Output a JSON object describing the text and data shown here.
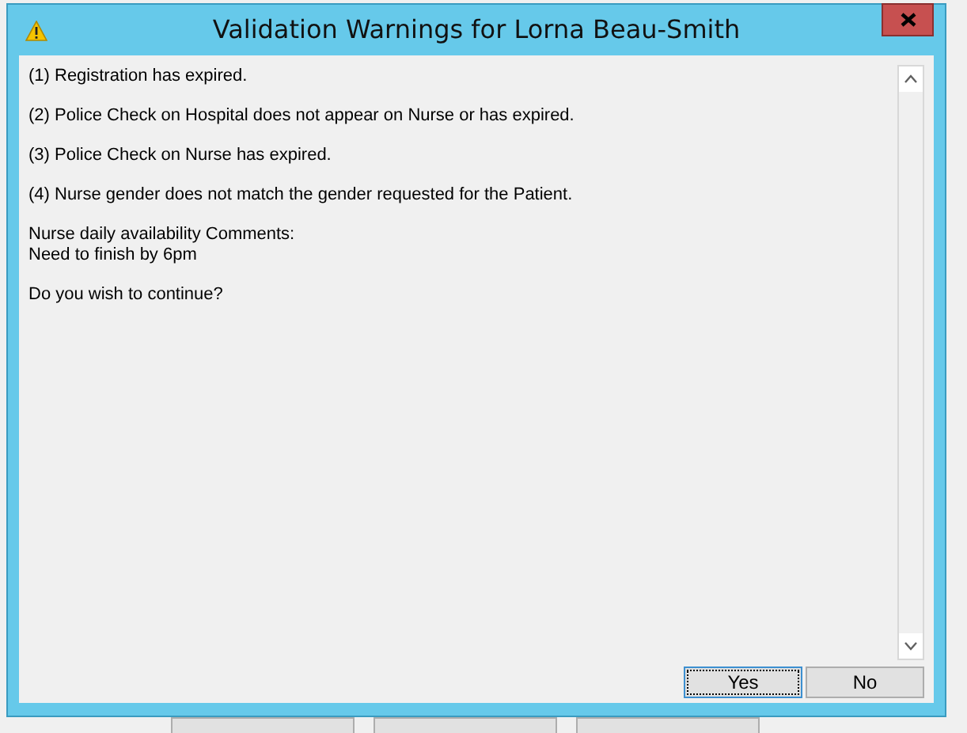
{
  "dialog": {
    "title": "Validation Warnings for Lorna Beau-Smith",
    "paragraphs": [
      [
        "(1) Registration has expired."
      ],
      [
        "(2) Police Check on Hospital does not appear on Nurse or has expired."
      ],
      [
        "(3) Police Check on Nurse has expired."
      ],
      [
        "(4) Nurse gender does not match the gender requested for the Patient."
      ],
      [
        "Nurse daily availability Comments:",
        "Need to finish by 6pm"
      ],
      [
        "Do you wish to continue?"
      ]
    ],
    "buttons": [
      {
        "label": "Yes",
        "selected": true
      },
      {
        "label": "No",
        "selected": false
      }
    ]
  }
}
